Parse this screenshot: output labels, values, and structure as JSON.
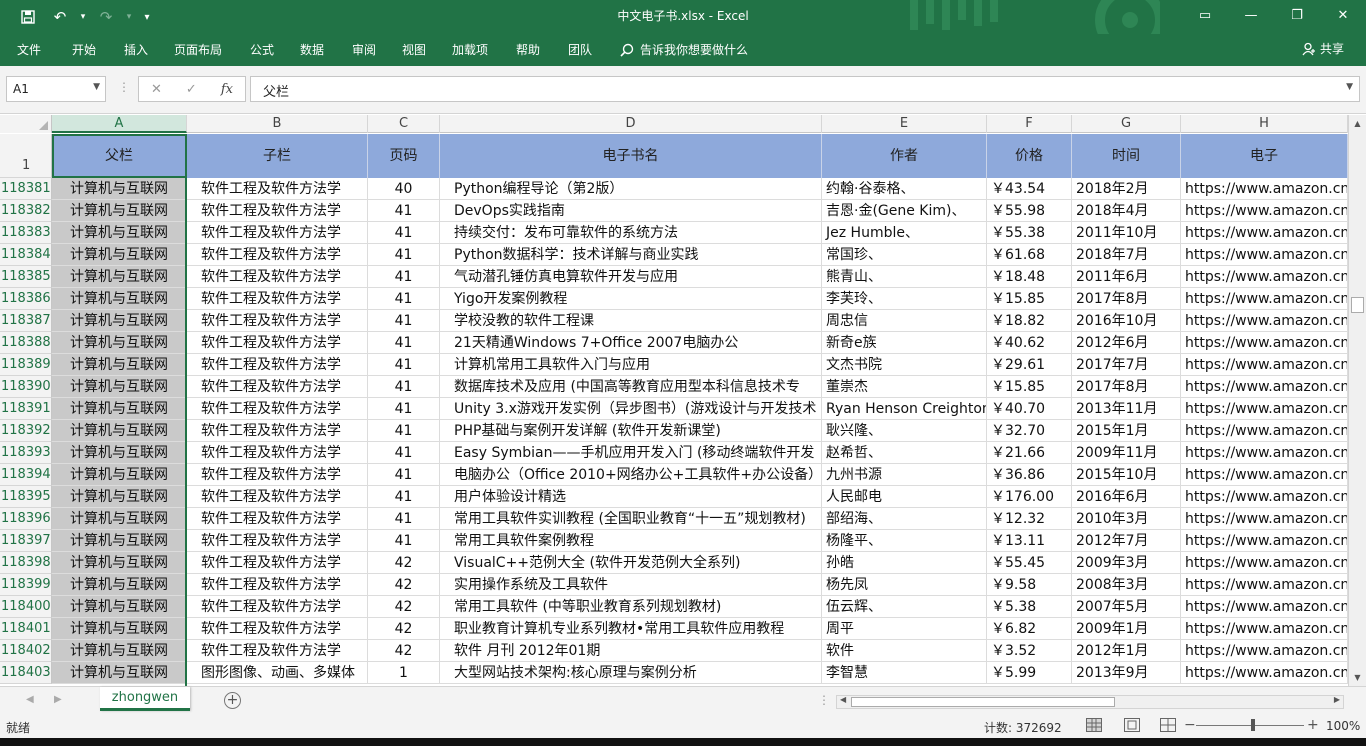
{
  "window": {
    "title": "中文电子书.xlsx  -  Excel",
    "minimize": "—",
    "restore": "❐",
    "close": "✕",
    "ribbon_display": "▭"
  },
  "qat": {
    "save_icon": "💾",
    "undo_icon": "↶",
    "redo_icon": "↷",
    "customize_icon": "▾"
  },
  "ribbon": {
    "tabs": [
      "文件",
      "开始",
      "插入",
      "页面布局",
      "公式",
      "数据",
      "审阅",
      "视图",
      "加载项",
      "帮助",
      "团队"
    ],
    "tell_me": "告诉我你想要做什么",
    "share": "共享"
  },
  "formula_bar": {
    "name_box": "A1",
    "separator": "⋮",
    "cancel": "✕",
    "enter": "✓",
    "fx": "fx",
    "content": "父栏"
  },
  "columns": [
    "A",
    "B",
    "C",
    "D",
    "E",
    "F",
    "G",
    "H"
  ],
  "header_row_num": "1",
  "header": [
    "父栏",
    "子栏",
    "页码",
    "电子书名",
    "作者",
    "价格",
    "时间",
    "电子"
  ],
  "rows": [
    {
      "num": "118381",
      "cells": [
        "计算机与互联网",
        "软件工程及软件方法学",
        "40",
        "Python编程导论（第2版）",
        "约翰·谷泰格、",
        "￥43.54",
        "2018年2月",
        "https://www.amazon.cn"
      ]
    },
    {
      "num": "118382",
      "cells": [
        "计算机与互联网",
        "软件工程及软件方法学",
        "41",
        "DevOps实践指南",
        "吉恩·金(Gene Kim)、",
        "￥55.98",
        "2018年4月",
        "https://www.amazon.cn"
      ]
    },
    {
      "num": "118383",
      "cells": [
        "计算机与互联网",
        "软件工程及软件方法学",
        "41",
        "持续交付：发布可靠软件的系统方法",
        "Jez Humble、",
        "￥55.38",
        "2011年10月",
        "https://www.amazon.cn"
      ]
    },
    {
      "num": "118384",
      "cells": [
        "计算机与互联网",
        "软件工程及软件方法学",
        "41",
        "Python数据科学：技术详解与商业实践",
        "常国珍、",
        "￥61.68",
        "2018年7月",
        "https://www.amazon.cn"
      ]
    },
    {
      "num": "118385",
      "cells": [
        "计算机与互联网",
        "软件工程及软件方法学",
        "41",
        "气动潜孔锤仿真电算软件开发与应用",
        "熊青山、",
        "￥18.48",
        "2011年6月",
        "https://www.amazon.cn"
      ]
    },
    {
      "num": "118386",
      "cells": [
        "计算机与互联网",
        "软件工程及软件方法学",
        "41",
        "Yigo开发案例教程",
        "李芙玲、",
        "￥15.85",
        "2017年8月",
        "https://www.amazon.cn"
      ]
    },
    {
      "num": "118387",
      "cells": [
        "计算机与互联网",
        "软件工程及软件方法学",
        "41",
        "学校没教的软件工程课",
        "周忠信",
        "￥18.82",
        "2016年10月",
        "https://www.amazon.cn"
      ]
    },
    {
      "num": "118388",
      "cells": [
        "计算机与互联网",
        "软件工程及软件方法学",
        "41",
        "21天精通Windows 7+Office 2007电脑办公",
        "新奇e族",
        "￥40.62",
        "2012年6月",
        "https://www.amazon.cn"
      ]
    },
    {
      "num": "118389",
      "cells": [
        "计算机与互联网",
        "软件工程及软件方法学",
        "41",
        "计算机常用工具软件入门与应用",
        "文杰书院",
        "￥29.61",
        "2017年7月",
        "https://www.amazon.cn"
      ]
    },
    {
      "num": "118390",
      "cells": [
        "计算机与互联网",
        "软件工程及软件方法学",
        "41",
        "数据库技术及应用 (中国高等教育应用型本科信息技术专",
        "董崇杰",
        "￥15.85",
        "2017年8月",
        "https://www.amazon.cn"
      ]
    },
    {
      "num": "118391",
      "cells": [
        "计算机与互联网",
        "软件工程及软件方法学",
        "41",
        "Unity 3.x游戏开发实例（异步图书）(游戏设计与开发技术",
        "Ryan Henson Creighton",
        "￥40.70",
        "2013年11月",
        "https://www.amazon.cn"
      ]
    },
    {
      "num": "118392",
      "cells": [
        "计算机与互联网",
        "软件工程及软件方法学",
        "41",
        "PHP基础与案例开发详解 (软件开发新课堂)",
        "耿兴隆、",
        "￥32.70",
        "2015年1月",
        "https://www.amazon.cn"
      ]
    },
    {
      "num": "118393",
      "cells": [
        "计算机与互联网",
        "软件工程及软件方法学",
        "41",
        "Easy Symbian——手机应用开发入门 (移动终端软件开发",
        "赵希哲、",
        "￥21.66",
        "2009年11月",
        "https://www.amazon.cn"
      ]
    },
    {
      "num": "118394",
      "cells": [
        "计算机与互联网",
        "软件工程及软件方法学",
        "41",
        "电脑办公（Office 2010+网络办公+工具软件+办公设备）",
        "九州书源",
        "￥36.86",
        "2015年10月",
        "https://www.amazon.cn"
      ]
    },
    {
      "num": "118395",
      "cells": [
        "计算机与互联网",
        "软件工程及软件方法学",
        "41",
        "用户体验设计精选",
        "人民邮电",
        "￥176.00",
        "2016年6月",
        "https://www.amazon.cn"
      ]
    },
    {
      "num": "118396",
      "cells": [
        "计算机与互联网",
        "软件工程及软件方法学",
        "41",
        "常用工具软件实训教程 (全国职业教育“十一五”规划教材)",
        "部绍海、",
        "￥12.32",
        "2010年3月",
        "https://www.amazon.cn"
      ]
    },
    {
      "num": "118397",
      "cells": [
        "计算机与互联网",
        "软件工程及软件方法学",
        "41",
        "常用工具软件案例教程",
        "杨隆平、",
        "￥13.11",
        "2012年7月",
        "https://www.amazon.cn"
      ]
    },
    {
      "num": "118398",
      "cells": [
        "计算机与互联网",
        "软件工程及软件方法学",
        "42",
        "VisualC++范例大全 (软件开发范例大全系列)",
        "孙皓",
        "￥55.45",
        "2009年3月",
        "https://www.amazon.cn"
      ]
    },
    {
      "num": "118399",
      "cells": [
        "计算机与互联网",
        "软件工程及软件方法学",
        "42",
        "实用操作系统及工具软件",
        "杨先凤",
        "￥9.58",
        "2008年3月",
        "https://www.amazon.cn"
      ]
    },
    {
      "num": "118400",
      "cells": [
        "计算机与互联网",
        "软件工程及软件方法学",
        "42",
        "常用工具软件 (中等职业教育系列规划教材)",
        "伍云辉、",
        "￥5.38",
        "2007年5月",
        "https://www.amazon.cn"
      ]
    },
    {
      "num": "118401",
      "cells": [
        "计算机与互联网",
        "软件工程及软件方法学",
        "42",
        "职业教育计算机专业系列教材•常用工具软件应用教程",
        "周平",
        "￥6.82",
        "2009年1月",
        "https://www.amazon.cn"
      ]
    },
    {
      "num": "118402",
      "cells": [
        "计算机与互联网",
        "软件工程及软件方法学",
        "42",
        "软件 月刊 2012年01期",
        "软件",
        "￥3.52",
        "2012年1月",
        "https://www.amazon.cn"
      ]
    },
    {
      "num": "118403",
      "cells": [
        "计算机与互联网",
        "图形图像、动画、多媒体",
        "1",
        "大型网站技术架构:核心原理与案例分析",
        "李智慧",
        "￥5.99",
        "2013年9月",
        "https://www.amazon.cn"
      ]
    }
  ],
  "sheet": {
    "tab": "zhongwen",
    "add": "+",
    "prev": "◀",
    "next": "▶"
  },
  "status": {
    "ready": "就绪",
    "count": "计数: 372692",
    "zoom": "100%",
    "zoom_minus": "−",
    "zoom_plus": "+"
  },
  "colors": {
    "accent": "#217346",
    "header_fill": "#8ea9db",
    "colA_fill": "#c9c9c9"
  }
}
